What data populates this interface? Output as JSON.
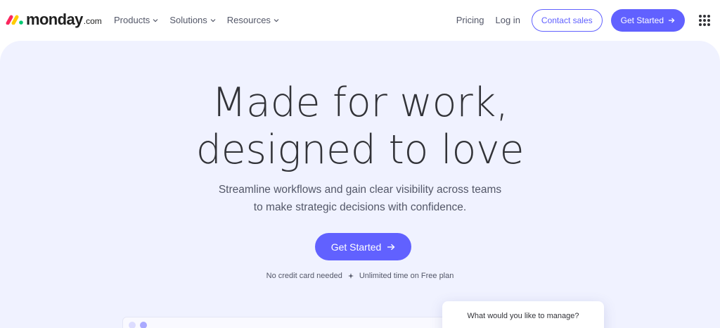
{
  "brand": {
    "name": "monday",
    "suffix": ".com"
  },
  "nav": {
    "menu": [
      {
        "label": "Products"
      },
      {
        "label": "Solutions"
      },
      {
        "label": "Resources"
      }
    ],
    "pricing": "Pricing",
    "login": "Log in",
    "contact_sales": "Contact sales",
    "get_started": "Get Started"
  },
  "hero": {
    "title_line1": "Made for work,",
    "title_line2": "designed to love",
    "subtitle_line1": "Streamline workflows and gain clear visibility across teams",
    "subtitle_line2": "to make strategic decisions with confidence.",
    "cta": "Get Started",
    "note_left": "No credit card needed",
    "note_right": "Unlimited time on Free plan"
  },
  "manage_card": {
    "question": "What would you like to manage?"
  },
  "colors": {
    "accent": "#6161ff",
    "hero_bg": "#f0f2ff",
    "text": "#323338",
    "logo_red": "#fb275d",
    "logo_yellow": "#ffcc00",
    "logo_green": "#00ca72"
  }
}
